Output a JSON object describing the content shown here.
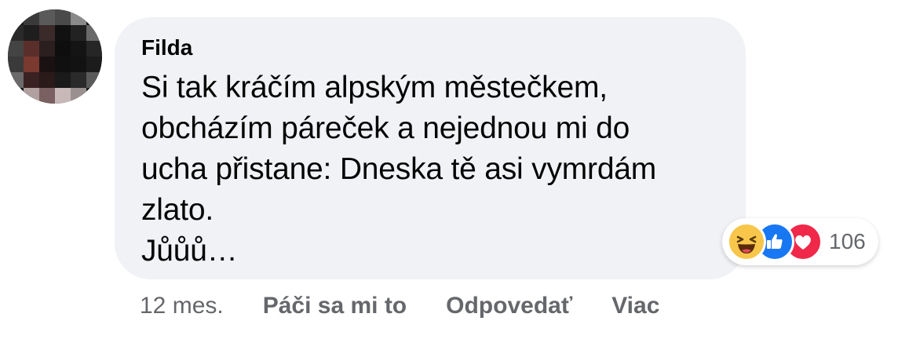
{
  "comment": {
    "author": "Filda",
    "text": "Si tak kráčím alpským městečkem,\nobcházím páreček a nejednou mi do\nucha přistane: Dneska tě asi vymrdám\nzlato.\nJůůů…",
    "reactions": {
      "icons": [
        "haha-icon",
        "like-icon",
        "love-icon"
      ],
      "count": "106"
    },
    "actions": {
      "time": "12 mes.",
      "like_label": "Páči sa mi to",
      "reply_label": "Odpovedať",
      "more_label": "Viac"
    }
  },
  "colors": {
    "bubble_bg": "#f0f2f5",
    "text": "#050505",
    "muted": "#65676b",
    "like": "#1877f2",
    "love": "#f0284a",
    "haha": "#f7c64a"
  }
}
